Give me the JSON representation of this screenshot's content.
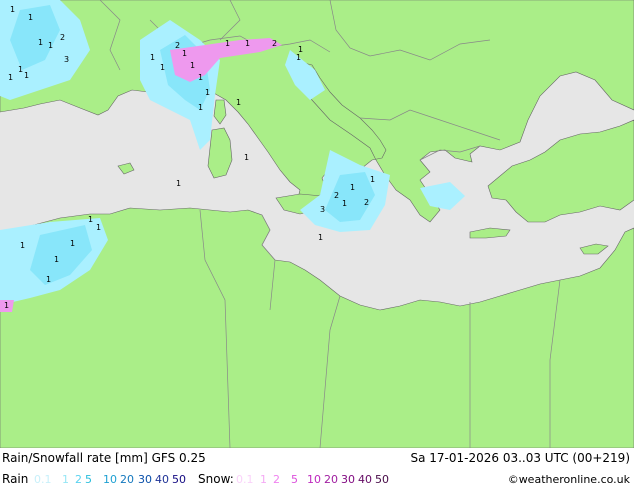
{
  "footer": {
    "title": "Rain/Snowfall rate [mm] GFS 0.25",
    "datetime": "Sa 17-01-2026 03..03 UTC (00+219)",
    "rain_label": "Rain",
    "snow_label": "Snow:",
    "credit": "©weatheronline.co.uk"
  },
  "legend": {
    "rain": [
      {
        "label": "0.1",
        "color": "#c8f0fa"
      },
      {
        "label": "1",
        "color": "#96e6f5"
      },
      {
        "label": "2",
        "color": "#5ad2f0"
      },
      {
        "label": "5",
        "color": "#28bedc"
      },
      {
        "label": "10",
        "color": "#1ea0d2"
      },
      {
        "label": "20",
        "color": "#1478be"
      },
      {
        "label": "30",
        "color": "#0a50aa"
      },
      {
        "label": "40",
        "color": "#1e3296"
      },
      {
        "label": "50",
        "color": "#140a82"
      }
    ],
    "snow": [
      {
        "label": "0.1",
        "color": "#fad2fa"
      },
      {
        "label": "1",
        "color": "#f5aaf5"
      },
      {
        "label": "2",
        "color": "#f082f0"
      },
      {
        "label": "5",
        "color": "#dc50dc"
      },
      {
        "label": "10",
        "color": "#be28be"
      },
      {
        "label": "20",
        "color": "#a01ea0"
      },
      {
        "label": "30",
        "color": "#820a82"
      },
      {
        "label": "40",
        "color": "#640a64"
      },
      {
        "label": "50",
        "color": "#460a46"
      }
    ]
  },
  "colors": {
    "land": "#aaee88",
    "sea": "#e6e6e6",
    "border": "#888888",
    "rain_light": "#aaf0ff",
    "rain_medium": "#88e6fa",
    "snow": "#ee99ee"
  },
  "map_values": [
    "1",
    "1",
    "1",
    "1",
    "2",
    "3",
    "1",
    "1",
    "1",
    "1",
    "1",
    "2",
    "1",
    "1",
    "1",
    "1",
    "1",
    "1",
    "1",
    "2",
    "1",
    "1",
    "1",
    "1",
    "1",
    "3",
    "2",
    "1",
    "1",
    "1",
    "2",
    "1",
    "1",
    "1",
    "1",
    "1",
    "1",
    "1",
    "1"
  ]
}
